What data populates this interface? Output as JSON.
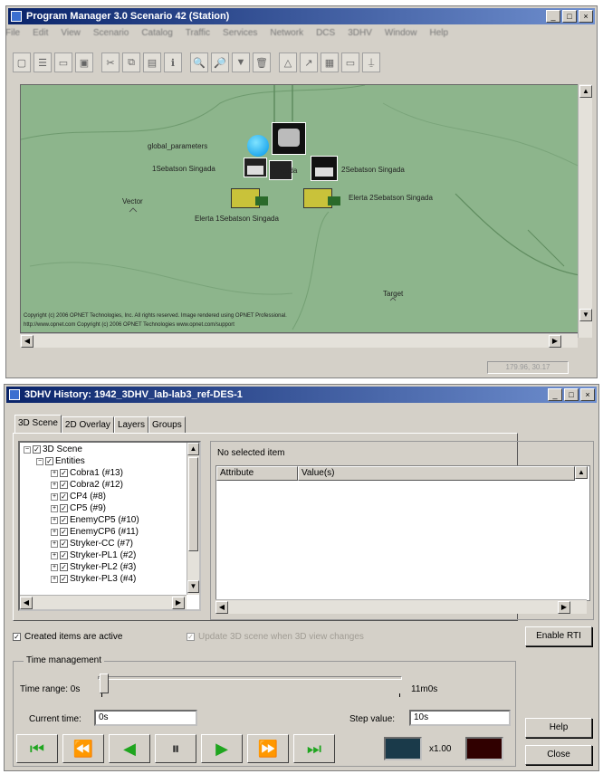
{
  "main_window": {
    "title": "Program Manager 3.0 Scenario 42 (Station)",
    "controls": [
      "_",
      "□",
      "×"
    ],
    "menu": [
      "File",
      "Edit",
      "View",
      "Scenario",
      "Catalog",
      "Traffic",
      "Services",
      "Network",
      "DCS",
      "3DHV",
      "Window",
      "Help"
    ],
    "toolbar_icons": [
      "new-icon",
      "open-icon",
      "save-icon",
      "print-icon",
      "cut-icon",
      "copy-icon",
      "paste-icon",
      "info-icon",
      "zoom-in-icon",
      "zoom-out-icon",
      "filter-icon",
      "delete-icon",
      "triangle-icon",
      "arrow-icon",
      "grid-icon",
      "window-icon",
      "stop-icon"
    ],
    "toolbar_glyphs": [
      "▢",
      "☰",
      "▭",
      "▣",
      "✂",
      "⧉",
      "▤",
      "ℹ",
      "🔍",
      "🔎",
      "▼",
      "🗑",
      "△",
      "↗",
      "▦",
      "▭",
      "⍊"
    ],
    "map": {
      "labels": {
        "global": "global_parameters",
        "s1": "1Sebatson Singada",
        "s2": "Singada",
        "s3": "2Sebatson Singada",
        "e2": "Elerta 2Sebatson Singada",
        "e1": "Elerta 1Sebatson Singada",
        "vector": "Vector",
        "target": "Target"
      },
      "copyright1": "Copyright (c) 2006 OPNET Technologies, Inc. All rights reserved. Image rendered using OPNET Professional.",
      "copyright2": "http://www.opnet.com  Copyright (c) 2006 OPNET Technologies  www.opnet.com/support"
    },
    "status_coords": "179.96, 30.17"
  },
  "history_window": {
    "title": "3DHV History: 1942_3DHV_lab-lab3_ref-DES-1",
    "controls": [
      "_",
      "□",
      "×"
    ],
    "tabs": [
      "3D Scene",
      "2D Overlay",
      "Layers",
      "Groups"
    ],
    "tree": {
      "root": "3D Scene",
      "entities": "Entities",
      "items": [
        "Cobra1 (#13)",
        "Cobra2 (#12)",
        "CP4 (#8)",
        "CP5 (#9)",
        "EnemyCP5 (#10)",
        "EnemyCP6 (#11)",
        "Stryker-CC (#7)",
        "Stryker-PL1 (#2)",
        "Stryker-PL2 (#3)",
        "Stryker-PL3 (#4)"
      ]
    },
    "props": {
      "caption": "No selected item",
      "col_attribute": "Attribute",
      "col_values": "Value(s)"
    },
    "check_created": "Created items are active",
    "check_update": "Update 3D scene when 3D view changes",
    "enable_rti": "Enable RTI",
    "time_group": "Time management",
    "time_range_label": "Time range: 0s",
    "time_range_end": "11m0s",
    "current_time_label": "Current time:",
    "current_time_value": "0s",
    "step_label": "Step value:",
    "step_value": "10s",
    "speed": "x1.00",
    "help": "Help",
    "close": "Close",
    "playback": [
      "skip-back-icon",
      "rewind-icon",
      "step-back-icon",
      "pause-icon",
      "play-icon",
      "fast-forward-icon",
      "skip-forward-icon"
    ],
    "playback_glyphs": [
      "⏮",
      "⏪",
      "◀",
      "⏸",
      "▶",
      "⏩",
      "⏭"
    ],
    "accent_green": "#1fa51f",
    "swatch1": "#1a3a4a",
    "swatch2": "#300000"
  }
}
